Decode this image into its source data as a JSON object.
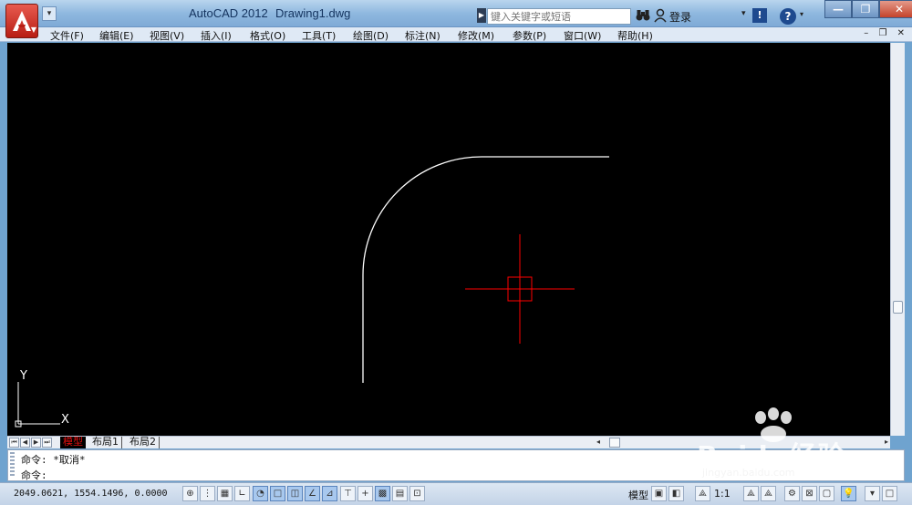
{
  "titlebar": {
    "app_title": "AutoCAD 2012",
    "doc_title": "Drawing1.dwg",
    "search_placeholder": "键入关键字或短语",
    "login_label": "登录",
    "help_glyph": "?",
    "exchange_glyph": "!",
    "minimize_glyph": "—",
    "restore_glyph": "❐",
    "close_glyph": "✕"
  },
  "menubar": {
    "items": [
      {
        "label": "文件(F)"
      },
      {
        "label": "编辑(E)"
      },
      {
        "label": "视图(V)"
      },
      {
        "label": "插入(I)"
      },
      {
        "label": "格式(O)"
      },
      {
        "label": "工具(T)"
      },
      {
        "label": "绘图(D)"
      },
      {
        "label": "标注(N)"
      },
      {
        "label": "修改(M)"
      },
      {
        "label": "参数(P)"
      },
      {
        "label": "窗口(W)"
      },
      {
        "label": "帮助(H)"
      }
    ],
    "doc_controls": "– ❐ ✕"
  },
  "canvas": {
    "background": "#000000",
    "geometry_color": "#ffffff",
    "crosshair_color": "#ff0000",
    "ucs_x_label": "X",
    "ucs_y_label": "Y"
  },
  "layout_tabs": {
    "tabs": [
      {
        "label": "模型"
      },
      {
        "label": "布局1"
      },
      {
        "label": "布局2"
      }
    ]
  },
  "command": {
    "history": "命令: *取消*",
    "prompt": "命令:"
  },
  "statusbar": {
    "coordinates": "2049.0621, 1554.1496, 0.0000",
    "model_label": "模型",
    "scale_label": "1:1"
  },
  "watermark": {
    "brand": "Baidu经验",
    "url": "jingyan.baidu.com"
  }
}
